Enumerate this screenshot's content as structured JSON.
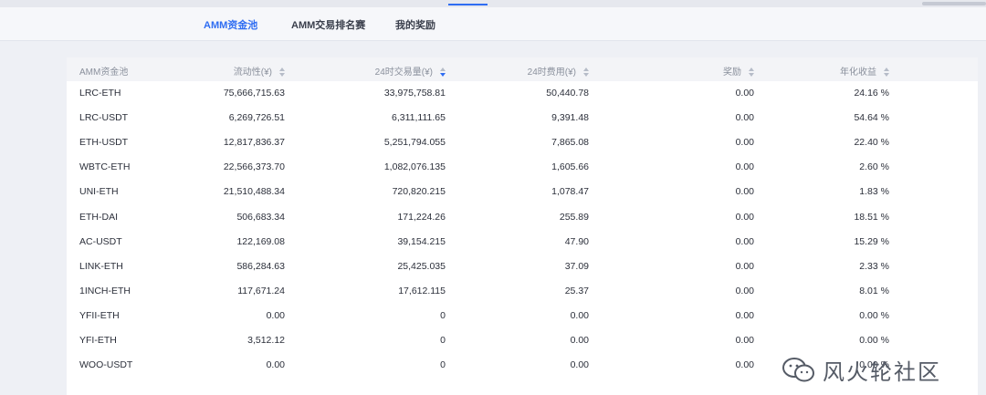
{
  "tabs": [
    {
      "label": "AMM资金池",
      "active": true
    },
    {
      "label": "AMM交易排名赛",
      "active": false
    },
    {
      "label": "我的奖励",
      "active": false
    }
  ],
  "table": {
    "columns": [
      {
        "label": "AMM资金池",
        "sortable": false
      },
      {
        "label": "流动性(¥)",
        "sortable": true,
        "sort": "none"
      },
      {
        "label": "24时交易量(¥)",
        "sortable": true,
        "sort": "desc"
      },
      {
        "label": "24时费用(¥)",
        "sortable": true,
        "sort": "none"
      },
      {
        "label": "奖励",
        "sortable": true,
        "sort": "none"
      },
      {
        "label": "年化收益",
        "sortable": true,
        "sort": "none"
      }
    ],
    "rows": [
      [
        "LRC-ETH",
        "75,666,715.63",
        "33,975,758.81",
        "50,440.78",
        "0.00",
        "24.16 %"
      ],
      [
        "LRC-USDT",
        "6,269,726.51",
        "6,311,111.65",
        "9,391.48",
        "0.00",
        "54.64 %"
      ],
      [
        "ETH-USDT",
        "12,817,836.37",
        "5,251,794.055",
        "7,865.08",
        "0.00",
        "22.40 %"
      ],
      [
        "WBTC-ETH",
        "22,566,373.70",
        "1,082,076.135",
        "1,605.66",
        "0.00",
        "2.60 %"
      ],
      [
        "UNI-ETH",
        "21,510,488.34",
        "720,820.215",
        "1,078.47",
        "0.00",
        "1.83 %"
      ],
      [
        "ETH-DAI",
        "506,683.34",
        "171,224.26",
        "255.89",
        "0.00",
        "18.51 %"
      ],
      [
        "AC-USDT",
        "122,169.08",
        "39,154.215",
        "47.90",
        "0.00",
        "15.29 %"
      ],
      [
        "LINK-ETH",
        "586,284.63",
        "25,425.035",
        "37.09",
        "0.00",
        "2.33 %"
      ],
      [
        "1INCH-ETH",
        "117,671.24",
        "17,612.115",
        "25.37",
        "0.00",
        "8.01 %"
      ],
      [
        "YFII-ETH",
        "0.00",
        "0",
        "0.00",
        "0.00",
        "0.00 %"
      ],
      [
        "YFI-ETH",
        "3,512.12",
        "0",
        "0.00",
        "0.00",
        "0.00 %"
      ],
      [
        "WOO-USDT",
        "0.00",
        "0",
        "0.00",
        "0.00",
        "0.00 %"
      ]
    ]
  },
  "watermark": {
    "text": "风火轮社区",
    "icon": "wechat-icon"
  },
  "colors": {
    "accent": "#2f6df2",
    "background": "#eef0f5",
    "header_bg": "#f3f4f7"
  }
}
